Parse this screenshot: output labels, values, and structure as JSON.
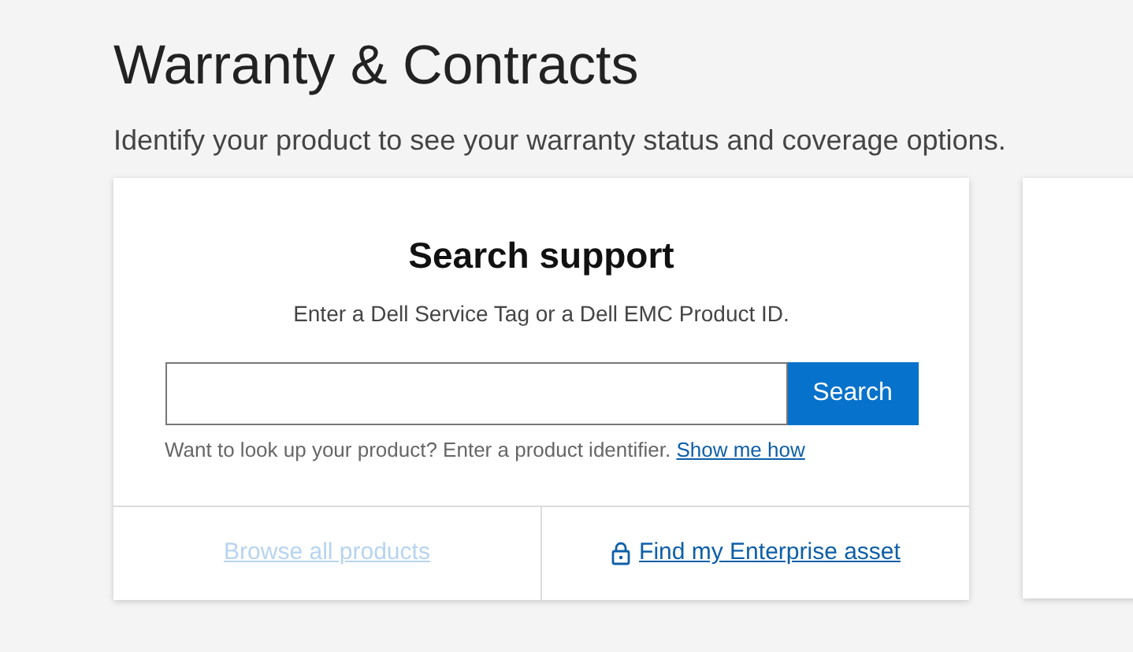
{
  "page": {
    "title": "Warranty & Contracts",
    "subtitle": "Identify your product to see your warranty status and coverage options."
  },
  "search_card": {
    "title": "Search support",
    "description": "Enter a Dell Service Tag or a Dell EMC Product ID.",
    "search_button": "Search",
    "help_text": "Want to look up your product? Enter a product identifier.",
    "help_link": "Show me how",
    "footer_links": [
      {
        "kind": "plain",
        "label": "Browse all products",
        "disabled": true
      },
      {
        "kind": "lock",
        "label": "Find my Enterprise asset",
        "disabled": false
      }
    ]
  }
}
